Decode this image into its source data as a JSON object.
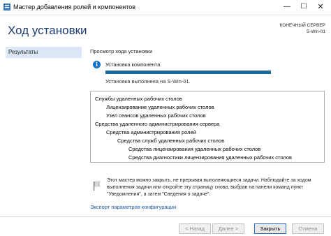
{
  "window": {
    "title": "Мастер добавления ролей и компонентов",
    "minimize_glyph": "—",
    "maximize_glyph": "☐",
    "close_glyph": "✕"
  },
  "header": {
    "heading": "Ход установки",
    "server_line1": "КОНЕЧНЫЙ СЕРВЕР",
    "server_line2": "S-Win-01"
  },
  "sidebar": {
    "items": [
      {
        "label": "Результаты",
        "selected": true
      }
    ]
  },
  "main": {
    "section_title": "Просмотр хода установки",
    "info_glyph": "i",
    "status_label": "Установка компонента",
    "progress": 1.0,
    "status_sub": "Установка выполнена на S-Win-01.",
    "results": [
      {
        "text": "Службы удаленных рабочих столов",
        "level": 0
      },
      {
        "text": "Лицензирование удаленных рабочих столов",
        "level": 1
      },
      {
        "text": "Узел сеансов удаленных рабочих столов",
        "level": 1
      },
      {
        "text": "Средства удаленного администрирования сервера",
        "level": 0
      },
      {
        "text": "Средства администрирования ролей",
        "level": 1
      },
      {
        "text": "Средства служб удаленных рабочих столов",
        "level": 2
      },
      {
        "text": "Средства лицензирования удаленных рабочих столов",
        "level": 3
      },
      {
        "text": "Средства диагностики лицензирования удаленных рабочих столов",
        "level": 3
      }
    ],
    "note": "Этот мастер можно закрыть, не прерывая выполняющиеся задачи. Наблюдайте за ходом выполнения задачи или откройте эту страницу снова, выбрав на панели команд пункт \"Уведомления\", а затем \"Сведения о задаче\".",
    "export_link": "Экспорт параметров конфигурации"
  },
  "footer": {
    "back": "< Назад",
    "next": "Далее >",
    "close": "Закрыть",
    "cancel": "Отмена"
  },
  "colors": {
    "heading": "#1e3a6e",
    "accent": "#1b6a9e",
    "info_icon": "#1473c8",
    "nav_selected": "#dbe7f5",
    "link": "#1a56a8"
  },
  "icons": {
    "app": "server-manager-icon",
    "info": "info-icon",
    "note": "flag-icon"
  }
}
